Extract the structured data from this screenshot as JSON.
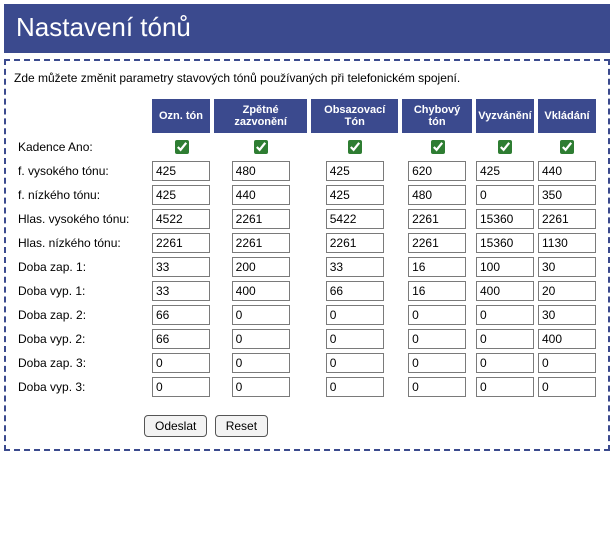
{
  "title": "Nastavení tónů",
  "intro": "Zde můžete změnit parametry stavových tónů používaných při telefonickém spojení.",
  "columns": [
    {
      "key": "ozn",
      "label": "Ozn. tón"
    },
    {
      "key": "zpet",
      "label": "Zpětné zazvonění"
    },
    {
      "key": "obs",
      "label": "Obsazovací Tón"
    },
    {
      "key": "chyb",
      "label": "Chybový tón"
    },
    {
      "key": "vyzv",
      "label": "Vyzvánění"
    },
    {
      "key": "vkl",
      "label": "Vkládání"
    }
  ],
  "rows": [
    {
      "key": "kadence",
      "label": "Kadence Ano:",
      "type": "checkbox",
      "values": {
        "ozn": true,
        "zpet": true,
        "obs": true,
        "chyb": true,
        "vyzv": true,
        "vkl": true
      }
    },
    {
      "key": "f_high",
      "label": "f. vysokého tónu:",
      "type": "number",
      "values": {
        "ozn": "425",
        "zpet": "480",
        "obs": "425",
        "chyb": "620",
        "vyzv": "425",
        "vkl": "440"
      }
    },
    {
      "key": "f_low",
      "label": "f. nízkého tónu:",
      "type": "number",
      "values": {
        "ozn": "425",
        "zpet": "440",
        "obs": "425",
        "chyb": "480",
        "vyzv": "0",
        "vkl": "350"
      }
    },
    {
      "key": "vol_high",
      "label": "Hlas. vysokého tónu:",
      "type": "number",
      "values": {
        "ozn": "4522",
        "zpet": "2261",
        "obs": "5422",
        "chyb": "2261",
        "vyzv": "15360",
        "vkl": "2261"
      }
    },
    {
      "key": "vol_low",
      "label": "Hlas. nízkého tónu:",
      "type": "number",
      "values": {
        "ozn": "2261",
        "zpet": "2261",
        "obs": "2261",
        "chyb": "2261",
        "vyzv": "15360",
        "vkl": "1130"
      }
    },
    {
      "key": "on1",
      "label": "Doba zap. 1:",
      "type": "number",
      "values": {
        "ozn": "33",
        "zpet": "200",
        "obs": "33",
        "chyb": "16",
        "vyzv": "100",
        "vkl": "30"
      }
    },
    {
      "key": "off1",
      "label": "Doba vyp. 1:",
      "type": "number",
      "values": {
        "ozn": "33",
        "zpet": "400",
        "obs": "66",
        "chyb": "16",
        "vyzv": "400",
        "vkl": "20"
      }
    },
    {
      "key": "on2",
      "label": "Doba zap. 2:",
      "type": "number",
      "values": {
        "ozn": "66",
        "zpet": "0",
        "obs": "0",
        "chyb": "0",
        "vyzv": "0",
        "vkl": "30"
      }
    },
    {
      "key": "off2",
      "label": "Doba vyp. 2:",
      "type": "number",
      "values": {
        "ozn": "66",
        "zpet": "0",
        "obs": "0",
        "chyb": "0",
        "vyzv": "0",
        "vkl": "400"
      }
    },
    {
      "key": "on3",
      "label": "Doba zap. 3:",
      "type": "number",
      "values": {
        "ozn": "0",
        "zpet": "0",
        "obs": "0",
        "chyb": "0",
        "vyzv": "0",
        "vkl": "0"
      }
    },
    {
      "key": "off3",
      "label": "Doba vyp. 3:",
      "type": "number",
      "values": {
        "ozn": "0",
        "zpet": "0",
        "obs": "0",
        "chyb": "0",
        "vyzv": "0",
        "vkl": "0"
      }
    }
  ],
  "buttons": {
    "submit": "Odeslat",
    "reset": "Reset"
  }
}
